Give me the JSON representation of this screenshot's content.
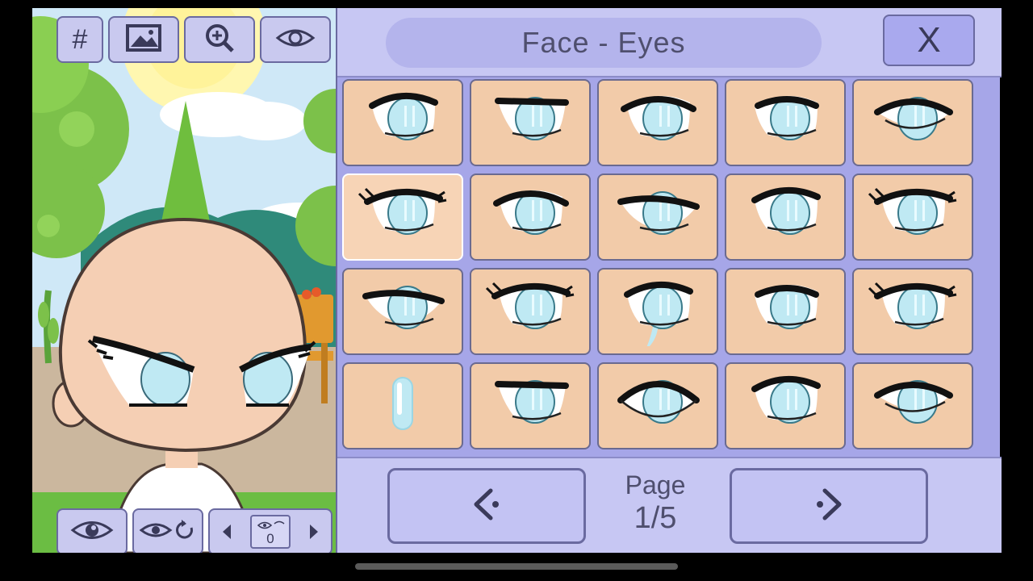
{
  "preview": {
    "toolbar": {
      "grid_label": "#",
      "background_icon": "image-icon",
      "zoom_icon": "zoom-in-icon",
      "hide_ui_icon": "eye-icon"
    },
    "bottom_bar": {
      "toggle_eyes_icon": "eye-icon",
      "reset_eyes_icon": "eye-refresh-icon",
      "eye_preset_value": "0"
    }
  },
  "panel": {
    "title": "Face - Eyes",
    "close_label": "X",
    "page_label": "Page",
    "page_value": "1/5",
    "prev_icon": "chevron-left-icon",
    "next_icon": "chevron-right-icon"
  },
  "eye_options": [
    {
      "style": "round"
    },
    {
      "style": "flat-top"
    },
    {
      "style": "sharp"
    },
    {
      "style": "soft"
    },
    {
      "style": "almond"
    },
    {
      "style": "lashes"
    },
    {
      "style": "sharp"
    },
    {
      "style": "narrow"
    },
    {
      "style": "round"
    },
    {
      "style": "lashes"
    },
    {
      "style": "narrow"
    },
    {
      "style": "lashes"
    },
    {
      "style": "tear"
    },
    {
      "style": "soft"
    },
    {
      "style": "lashes"
    },
    {
      "style": "shine"
    },
    {
      "style": "flat-top"
    },
    {
      "style": "wide"
    },
    {
      "style": "round"
    },
    {
      "style": "almond"
    }
  ],
  "colors": {
    "panel_bg": "#a6a6e8",
    "button_bg": "#c3c3f3",
    "cell_bg": "#f2cba9",
    "iris": "#bfe9f3",
    "skin": "#f5cfb4"
  }
}
